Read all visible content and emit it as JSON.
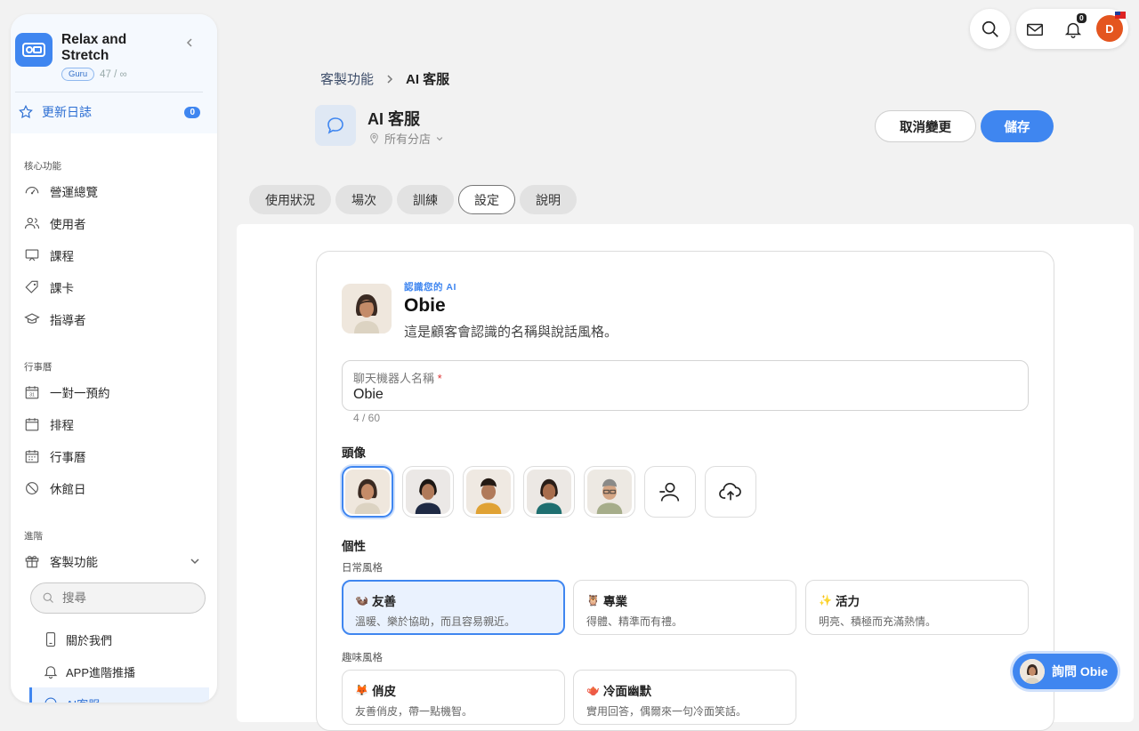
{
  "org": {
    "name": "Relax and Stretch",
    "plan": "Guru",
    "usage": "47 / ∞"
  },
  "changelog": {
    "label": "更新日誌",
    "count": "0"
  },
  "sidebar": {
    "core_title": "核心功能",
    "core_items": [
      {
        "label": "營運總覽",
        "icon": "dashboard-icon"
      },
      {
        "label": "使用者",
        "icon": "users-icon"
      },
      {
        "label": "課程",
        "icon": "class-icon"
      },
      {
        "label": "課卡",
        "icon": "ticket-icon"
      },
      {
        "label": "指導者",
        "icon": "instructor-icon"
      }
    ],
    "calendar_title": "行事曆",
    "calendar_items": [
      {
        "label": "一對一預約",
        "icon": "appointment-icon"
      },
      {
        "label": "排程",
        "icon": "schedule-icon"
      },
      {
        "label": "行事曆",
        "icon": "calendar-icon"
      },
      {
        "label": "休館日",
        "icon": "closed-icon"
      }
    ],
    "advanced_title": "進階",
    "advanced_group": "客製功能",
    "search_placeholder": "搜尋",
    "sub_items": [
      "關於我們",
      "APP進階推播",
      "AI客服"
    ]
  },
  "topbar": {
    "bell_count": "0",
    "avatar_initial": "D"
  },
  "breadcrumb": {
    "parent": "客製功能",
    "current": "AI 客服"
  },
  "header": {
    "title": "AI 客服",
    "branch": "所有分店",
    "cancel_label": "取消變更",
    "save_label": "儲存"
  },
  "tabs": [
    "使用狀況",
    "場次",
    "訓練",
    "設定",
    "說明"
  ],
  "active_tab": "設定",
  "intro": {
    "eyebrow": "認識您的 AI",
    "name": "Obie",
    "description": "這是顧客會認識的名稱與說話風格。"
  },
  "bot_name_field": {
    "label": "聊天機器人名稱",
    "required_mark": "*",
    "value": "Obie",
    "count": "4 / 60"
  },
  "avatar_section": {
    "label": "頭像"
  },
  "personality": {
    "label": "個性",
    "daily_label": "日常風格",
    "daily": [
      {
        "emoji": "🦦",
        "title": "友善",
        "desc": "溫暖、樂於協助，而且容易親近。",
        "selected": true
      },
      {
        "emoji": "🦉",
        "title": "專業",
        "desc": "得體、精準而有禮。",
        "selected": false
      },
      {
        "emoji": "✨",
        "title": "活力",
        "desc": "明亮、積極而充滿熱情。",
        "selected": false
      }
    ],
    "fun_label": "趣味風格",
    "fun": [
      {
        "emoji": "🦊",
        "title": "俏皮",
        "desc": "友善俏皮，帶一點機智。"
      },
      {
        "emoji": "🫖",
        "title": "冷面幽默",
        "desc": "實用回答，偶爾來一句冷面笑話。"
      }
    ]
  },
  "ask_button": {
    "label": "詢問 Obie"
  },
  "colors": {
    "accent": "#3f86f0",
    "avatar_bg": "#e4551f"
  }
}
